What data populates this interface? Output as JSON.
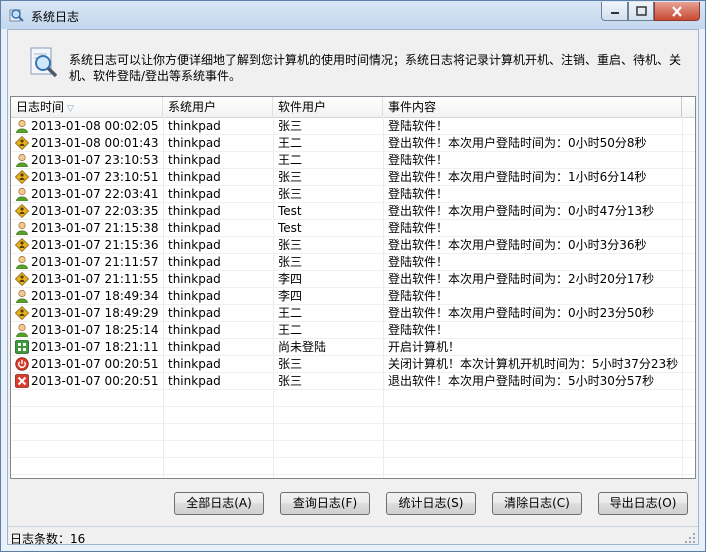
{
  "window": {
    "title": "系统日志"
  },
  "info": {
    "text": "系统日志可以让你方便详细地了解到您计算机的使用时间情况；系统日志将记录计算机开机、注销、重启、待机、关机、软件登陆/登出等系统事件。"
  },
  "table": {
    "columns": [
      "日志时间",
      "系统用户",
      "软件用户",
      "事件内容"
    ],
    "sort_indicator": "▽",
    "rows": [
      {
        "icon": "user-icon",
        "time": "2013-01-08 00:02:05",
        "sys_user": "thinkpad",
        "soft_user": "张三",
        "event": "登陆软件！"
      },
      {
        "icon": "logout-icon",
        "time": "2013-01-08 00:01:43",
        "sys_user": "thinkpad",
        "soft_user": "王二",
        "event": "登出软件！本次用户登陆时间为：0小时50分8秒"
      },
      {
        "icon": "user-icon",
        "time": "2013-01-07 23:10:53",
        "sys_user": "thinkpad",
        "soft_user": "王二",
        "event": "登陆软件！"
      },
      {
        "icon": "logout-icon",
        "time": "2013-01-07 23:10:51",
        "sys_user": "thinkpad",
        "soft_user": "张三",
        "event": "登出软件！本次用户登陆时间为：1小时6分14秒"
      },
      {
        "icon": "user-icon",
        "time": "2013-01-07 22:03:41",
        "sys_user": "thinkpad",
        "soft_user": "张三",
        "event": "登陆软件！"
      },
      {
        "icon": "logout-icon",
        "time": "2013-01-07 22:03:35",
        "sys_user": "thinkpad",
        "soft_user": "Test",
        "event": "登出软件！本次用户登陆时间为：0小时47分13秒"
      },
      {
        "icon": "user-icon",
        "time": "2013-01-07 21:15:38",
        "sys_user": "thinkpad",
        "soft_user": "Test",
        "event": "登陆软件！"
      },
      {
        "icon": "logout-icon",
        "time": "2013-01-07 21:15:36",
        "sys_user": "thinkpad",
        "soft_user": "张三",
        "event": "登出软件！本次用户登陆时间为：0小时3分36秒"
      },
      {
        "icon": "user-icon",
        "time": "2013-01-07 21:11:57",
        "sys_user": "thinkpad",
        "soft_user": "张三",
        "event": "登陆软件！"
      },
      {
        "icon": "logout-icon",
        "time": "2013-01-07 21:11:55",
        "sys_user": "thinkpad",
        "soft_user": "李四",
        "event": "登出软件！本次用户登陆时间为：2小时20分17秒"
      },
      {
        "icon": "user-icon",
        "time": "2013-01-07 18:49:34",
        "sys_user": "thinkpad",
        "soft_user": "李四",
        "event": "登陆软件！"
      },
      {
        "icon": "logout-icon",
        "time": "2013-01-07 18:49:29",
        "sys_user": "thinkpad",
        "soft_user": "王二",
        "event": "登出软件！本次用户登陆时间为：0小时23分50秒"
      },
      {
        "icon": "user-icon",
        "time": "2013-01-07 18:25:14",
        "sys_user": "thinkpad",
        "soft_user": "王二",
        "event": "登陆软件！"
      },
      {
        "icon": "power-on-icon",
        "time": "2013-01-07 18:21:11",
        "sys_user": "thinkpad",
        "soft_user": "尚未登陆",
        "event": "开启计算机！"
      },
      {
        "icon": "shutdown-icon",
        "time": "2013-01-07 00:20:51",
        "sys_user": "thinkpad",
        "soft_user": "张三",
        "event": "关闭计算机！本次计算机开机时间为：5小时37分23秒"
      },
      {
        "icon": "exit-icon",
        "time": "2013-01-07 00:20:51",
        "sys_user": "thinkpad",
        "soft_user": "张三",
        "event": "退出软件！本次用户登陆时间为：5小时30分57秒"
      }
    ]
  },
  "buttons": {
    "all_logs": "全部日志(A)",
    "query_logs": "查询日志(F)",
    "stats_logs": "统计日志(S)",
    "clear_logs": "清除日志(C)",
    "export_logs": "导出日志(O)"
  },
  "status": {
    "count_label": "日志条数：",
    "count_value": "16"
  },
  "colors": {
    "user_green": "#5aa02c",
    "logout_gold": "#e8b41c",
    "power_green": "#3c9a3c",
    "shutdown_red": "#d83c2c"
  }
}
